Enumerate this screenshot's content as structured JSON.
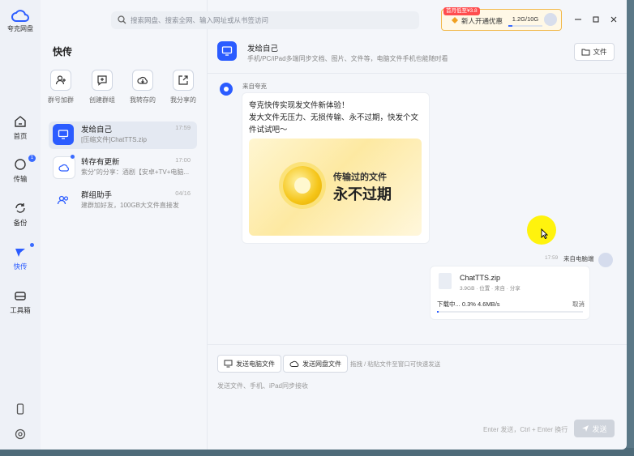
{
  "app": {
    "logo_text": "夸克网盘"
  },
  "search": {
    "placeholder": "搜索网盘、搜索全网、输入网址或从书签访问"
  },
  "promo": {
    "tag": "首月低至¥3.8",
    "text": "新人开通优惠",
    "storage": "1.2G/10G",
    "storage_fraction": 0.12
  },
  "nav": [
    {
      "label": "首页",
      "icon": "home-icon"
    },
    {
      "label": "传输",
      "icon": "transfer-icon",
      "badge": "1"
    },
    {
      "label": "备份",
      "icon": "backup-icon"
    },
    {
      "label": "快传",
      "icon": "quick-transfer-icon"
    },
    {
      "label": "工具箱",
      "icon": "toolbox-icon"
    }
  ],
  "panel": {
    "title": "快传",
    "quick_actions": [
      {
        "label": "群号加群",
        "icon": "add-user-icon"
      },
      {
        "label": "创建群组",
        "icon": "create-group-icon"
      },
      {
        "label": "我转存的",
        "icon": "cloud-save-icon"
      },
      {
        "label": "我分享的",
        "icon": "share-icon"
      }
    ],
    "conversations": [
      {
        "name": "发给自己",
        "sub": "[压缩文件]ChatTTS.zip",
        "time": "17:59"
      },
      {
        "name": "转存有更新",
        "sub": "紫分\"的分享：酒剧【安卓+TV+电脑...",
        "time": "17:00"
      },
      {
        "name": "群组助手",
        "sub": "建群加好友，100GB大文件直接发",
        "time": "04/16"
      }
    ]
  },
  "chat": {
    "title": "发给自己",
    "desc": "手机/PC/iPad多端同步文档、图片、文件等，电脑文件手机也能随时看",
    "file_button": "文件",
    "msg1": {
      "sender": "来自夸克",
      "line1": "夸克快传实现发文件新体验！",
      "line2": "发大文件无压力、无损传输、永不过期，快发个文件试试吧～",
      "banner_line1": "传输过的文件",
      "banner_line2": "永不过期"
    },
    "msg2": {
      "time": "17:59",
      "sender": "来自电脑端",
      "file_name": "ChatTTS.zip",
      "meta": "3.9GB · 位置 · 来自 · 分享",
      "status": "下载中... 0.3%  4.6MB/s",
      "progress": 0.003,
      "cancel": "取消"
    }
  },
  "composer": {
    "send_pc_file": "发送电脑文件",
    "send_cloud_file": "发送网盘文件",
    "hint": "拖拽 / 粘贴文件至窗口可快速发送",
    "placeholder": "发送文件、手机、iPad同步接收",
    "shortcut_hint": "Enter 发送，Ctrl + Enter 换行",
    "send": "发送"
  }
}
